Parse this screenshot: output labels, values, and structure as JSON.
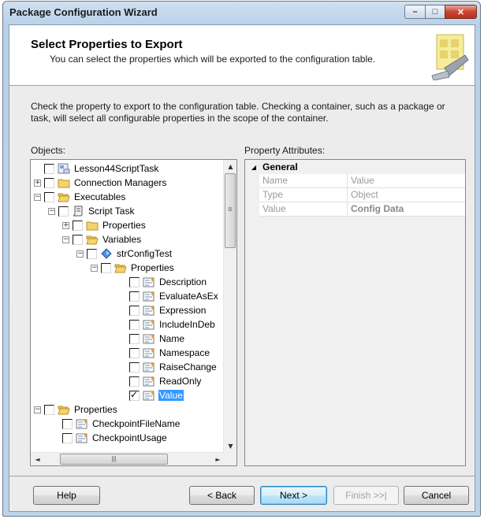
{
  "window": {
    "title": "Package Configuration Wizard"
  },
  "header": {
    "title": "Select Properties to Export",
    "subtitle": "You can select the properties which will be exported to the configuration table."
  },
  "instruction": "Check the property to export to the configuration table. Checking a container, such as a package or task, will select all configurable properties in the scope of the container.",
  "objects": {
    "label": "Objects:",
    "tree": [
      {
        "label": "Lesson44ScriptTask",
        "checked": false,
        "icon": "package-icon"
      },
      {
        "label": "Connection Managers",
        "checked": false,
        "icon": "folder-icon"
      },
      {
        "label": "Executables",
        "checked": false,
        "icon": "folder-open-icon"
      },
      {
        "label": "Script Task",
        "checked": false,
        "icon": "script-task-icon"
      },
      {
        "label": "Properties",
        "checked": false,
        "icon": "folder-icon"
      },
      {
        "label": "Variables",
        "checked": false,
        "icon": "folder-open-icon"
      },
      {
        "label": "strConfigTest",
        "checked": false,
        "icon": "variable-icon"
      },
      {
        "label": "Properties",
        "checked": false,
        "icon": "folder-open-icon"
      },
      {
        "label": "Description",
        "checked": false,
        "icon": "property-icon"
      },
      {
        "label": "EvaluateAsEx",
        "checked": false,
        "icon": "property-icon"
      },
      {
        "label": "Expression",
        "checked": false,
        "icon": "property-icon"
      },
      {
        "label": "IncludeInDeb",
        "checked": false,
        "icon": "property-icon"
      },
      {
        "label": "Name",
        "checked": false,
        "icon": "property-icon"
      },
      {
        "label": "Namespace",
        "checked": false,
        "icon": "property-icon"
      },
      {
        "label": "RaiseChange",
        "checked": false,
        "icon": "property-icon"
      },
      {
        "label": "ReadOnly",
        "checked": false,
        "icon": "property-icon"
      },
      {
        "label": "Value",
        "checked": true,
        "icon": "property-icon"
      },
      {
        "label": "Properties",
        "checked": false,
        "icon": "folder-open-icon"
      },
      {
        "label": "CheckpointFileName",
        "checked": false,
        "icon": "property-icon"
      },
      {
        "label": "CheckpointUsage",
        "checked": false,
        "icon": "property-icon"
      }
    ]
  },
  "property_attributes": {
    "label": "Property Attributes:",
    "category": "General",
    "rows": [
      {
        "name": "Name",
        "value": "Value"
      },
      {
        "name": "Type",
        "value": "Object"
      },
      {
        "name": "Value",
        "value": "Config Data"
      }
    ]
  },
  "buttons": {
    "help": "Help",
    "back": "< Back",
    "next": "Next >",
    "finish": "Finish >>|",
    "cancel": "Cancel"
  },
  "colors": {
    "selection": "#3399ff",
    "folder": "#f5d36a"
  }
}
